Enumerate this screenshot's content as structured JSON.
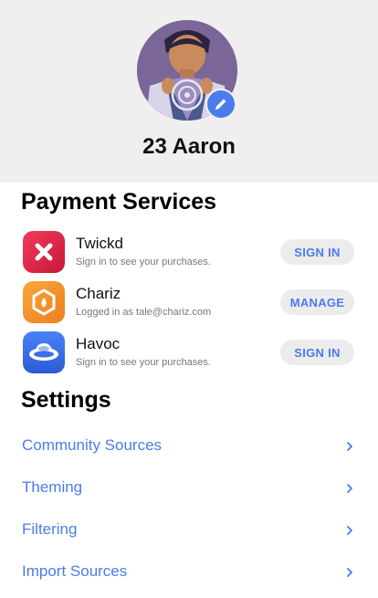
{
  "profile": {
    "username": "23 Aaron",
    "avatar_icon": "superhero-avatar-icon",
    "edit_icon": "pencil-icon"
  },
  "payment_services": {
    "title": "Payment Services",
    "items": [
      {
        "name": "Twickd",
        "subtitle": "Sign in to see your purchases.",
        "button": "SIGN IN",
        "icon": "twickd-logo-icon",
        "color": "#e8344e"
      },
      {
        "name": "Chariz",
        "subtitle": "Logged in as tale@chariz.com",
        "button": "MANAGE",
        "icon": "chariz-logo-icon",
        "color": "#f6952b"
      },
      {
        "name": "Havoc",
        "subtitle": "Sign in to see your purchases.",
        "button": "SIGN IN",
        "icon": "havoc-logo-icon",
        "color": "#3b6fe8"
      }
    ]
  },
  "settings": {
    "title": "Settings",
    "items": [
      {
        "label": "Community Sources"
      },
      {
        "label": "Theming"
      },
      {
        "label": "Filtering"
      },
      {
        "label": "Import Sources"
      }
    ]
  },
  "colors": {
    "accent": "#4b7bec",
    "header_bg": "#efefef",
    "button_bg": "#ececec"
  }
}
